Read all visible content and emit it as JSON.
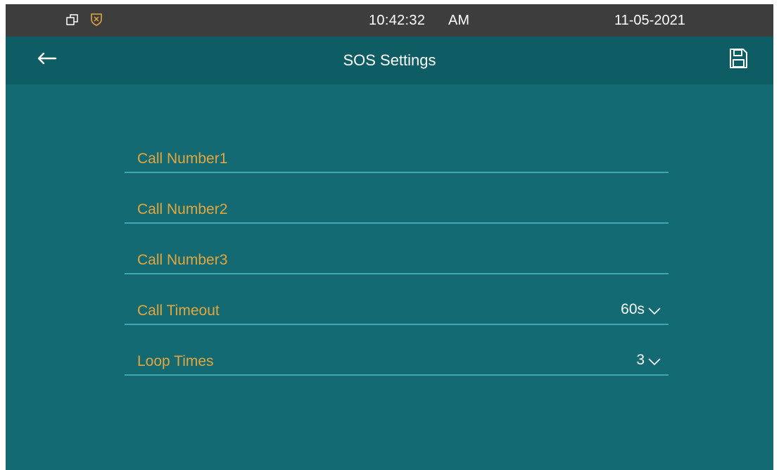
{
  "status_bar": {
    "time": "10:42:32",
    "ampm": "AM",
    "date": "11-05-2021",
    "icons": [
      "window-restore-icon",
      "shield-x-icon"
    ]
  },
  "header": {
    "title": "SOS Settings",
    "back_icon": "back-arrow-icon",
    "save_icon": "save-icon"
  },
  "form": {
    "rows": [
      {
        "label": "Call Number1",
        "value": ""
      },
      {
        "label": "Call Number2",
        "value": ""
      },
      {
        "label": "Call Number3",
        "value": ""
      },
      {
        "label": "Call Timeout",
        "value": "60s"
      },
      {
        "label": "Loop Times",
        "value": "3"
      }
    ]
  },
  "colors": {
    "background": "#136a72",
    "header": "#0f5d64",
    "status_bar": "#3d3d3d",
    "label": "#e3a63f",
    "underline": "#3fa7b1"
  }
}
